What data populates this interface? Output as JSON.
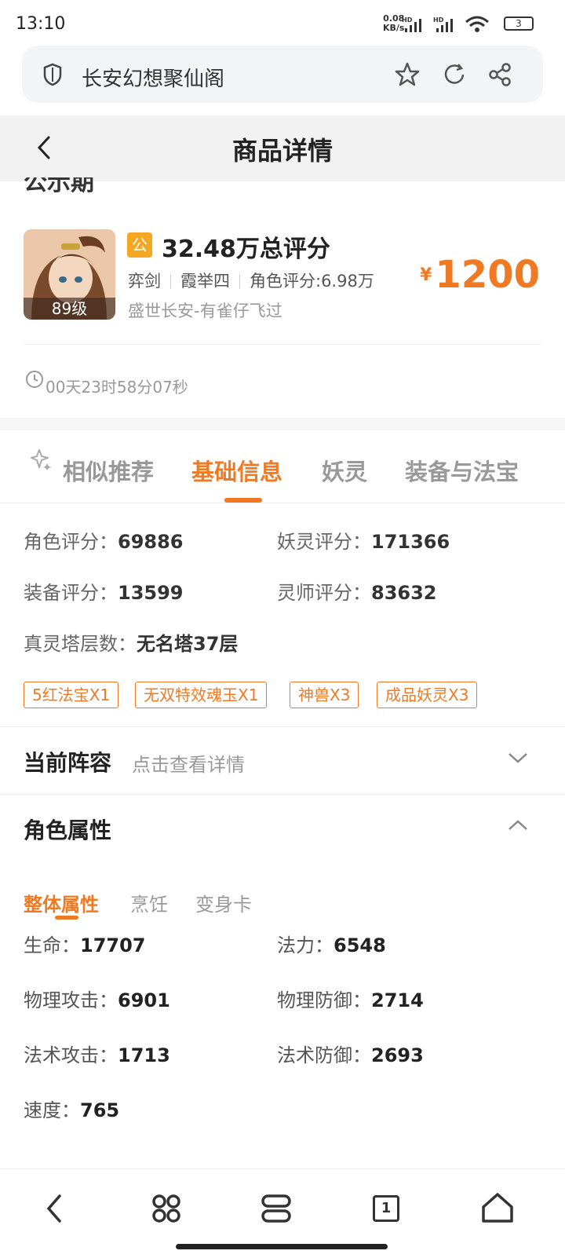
{
  "status_bar": {
    "time": "13:10",
    "net_speed_value": "0.08",
    "net_speed_unit": "KB/s",
    "battery": "3"
  },
  "browser": {
    "url_text": "长安幻想聚仙阁"
  },
  "header": {
    "title": "商品详情"
  },
  "product": {
    "name_cut": "公示期",
    "level": "89级",
    "badge": "公",
    "total_score": "32.48万总评分",
    "class": "弈剑",
    "server_tier": "霞举四",
    "role_score": "角色评分:6.98万",
    "server_owner": "盛世长安-有雀仔飞过",
    "price_currency": "¥",
    "price": "1200",
    "countdown": "00天23时58分07秒"
  },
  "tabs": [
    {
      "label": "相似推荐"
    },
    {
      "label": "基础信息"
    },
    {
      "label": "妖灵"
    },
    {
      "label": "装备与法宝"
    }
  ],
  "basic_info": {
    "role_score_label": "角色评分：",
    "role_score_value": "69886",
    "spirit_score_label": "妖灵评分：",
    "spirit_score_value": "171366",
    "equip_score_label": "装备评分：",
    "equip_score_value": "13599",
    "master_score_label": "灵师评分：",
    "master_score_value": "83632",
    "tower_label": "真灵塔层数：",
    "tower_value": "无名塔37层",
    "tags": [
      "5红法宝X1",
      "无双特效魂玉X1",
      "神兽X3",
      "成品妖灵X3"
    ]
  },
  "lineup": {
    "title": "当前阵容",
    "hint": "点击查看详情"
  },
  "attributes": {
    "title": "角色属性",
    "subtabs": [
      "整体属性",
      "烹饪",
      "变身卡"
    ],
    "hp_label": "生命：",
    "hp_value": "17707",
    "mp_label": "法力：",
    "mp_value": "6548",
    "patk_label": "物理攻击：",
    "patk_value": "6901",
    "pdef_label": "物理防御：",
    "pdef_value": "2714",
    "matk_label": "法术攻击：",
    "matk_value": "1713",
    "mdef_label": "法术防御：",
    "mdef_value": "2693",
    "speed_label": "速度：",
    "speed_value": "765"
  },
  "bottom_nav": {
    "tab_count": "1"
  },
  "colors": {
    "accent": "#f07a23",
    "badge": "#f5a623"
  }
}
